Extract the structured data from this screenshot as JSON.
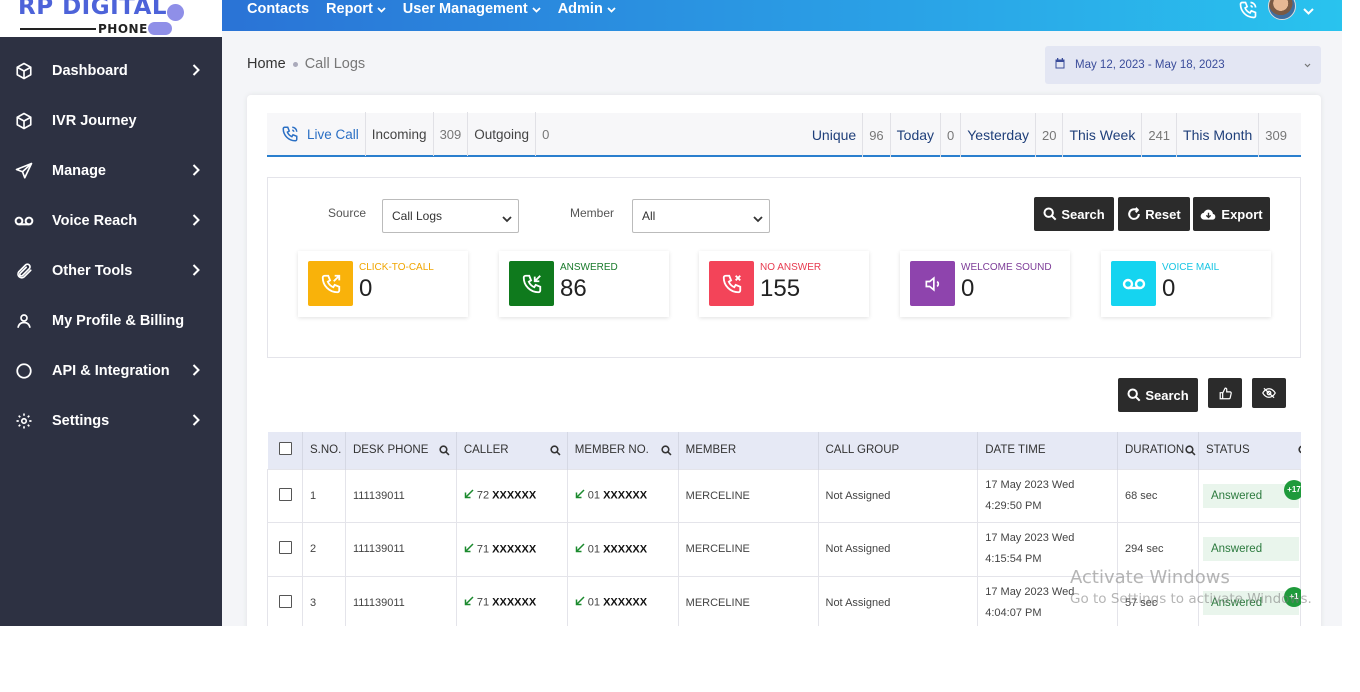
{
  "brand": {
    "name": "RP DIGITAL",
    "sub": "PHONE"
  },
  "sidebar": {
    "items": [
      {
        "label": "Dashboard",
        "icon": "cube-icon",
        "has_chevron": true
      },
      {
        "label": "IVR Journey",
        "icon": "cube-icon",
        "has_chevron": false
      },
      {
        "label": "Manage",
        "icon": "send-icon",
        "has_chevron": true
      },
      {
        "label": "Voice Reach",
        "icon": "voicemail-icon",
        "has_chevron": true
      },
      {
        "label": "Other Tools",
        "icon": "paperclip-icon",
        "has_chevron": true
      },
      {
        "label": "My Profile & Billing",
        "icon": "user-icon",
        "has_chevron": false
      },
      {
        "label": "API & Integration",
        "icon": "circle-icon",
        "has_chevron": true
      },
      {
        "label": "Settings",
        "icon": "gear-icon",
        "has_chevron": true
      }
    ]
  },
  "topnav": {
    "items": [
      {
        "label": "Contacts",
        "dropdown": false
      },
      {
        "label": "Report",
        "dropdown": true
      },
      {
        "label": "User Management",
        "dropdown": true
      },
      {
        "label": "Admin",
        "dropdown": true
      }
    ]
  },
  "breadcrumb": {
    "home": "Home",
    "current": "Call Logs"
  },
  "date_range": "May 12, 2023 - May 18, 2023",
  "tabs": {
    "live": "Live Call",
    "incoming": {
      "label": "Incoming",
      "count": "309"
    },
    "outgoing": {
      "label": "Outgoing",
      "count": "0"
    },
    "unique": {
      "label": "Unique",
      "count": "96"
    },
    "today": {
      "label": "Today",
      "count": "0"
    },
    "yesterday": {
      "label": "Yesterday",
      "count": "20"
    },
    "this_week": {
      "label": "This Week",
      "count": "241"
    },
    "this_month": {
      "label": "This Month",
      "count": "309"
    }
  },
  "filters": {
    "source_label": "Source",
    "source_value": "Call Logs",
    "member_label": "Member",
    "member_value": "All",
    "search_label": "Search",
    "reset_label": "Reset",
    "export_label": "Export"
  },
  "stats": [
    {
      "label": "CLICK-TO-CALL",
      "value": "0",
      "color": "#f9b20a",
      "label_color": "#f0a500",
      "icon": "phone-outgoing-icon"
    },
    {
      "label": "ANSWERED",
      "value": "86",
      "color": "#0f7a1d",
      "label_color": "#187a2a",
      "icon": "phone-incoming-icon"
    },
    {
      "label": "NO ANSWER",
      "value": "155",
      "color": "#f34459",
      "label_color": "#e73a4f",
      "icon": "phone-missed-icon"
    },
    {
      "label": "WELCOME SOUND",
      "value": "0",
      "color": "#8e44ad",
      "label_color": "#7d3c98",
      "icon": "speaker-icon"
    },
    {
      "label": "VOICE MAIL",
      "value": "0",
      "color": "#15d4f0",
      "label_color": "#16c5e3",
      "icon": "voicemail-icon"
    }
  ],
  "table_controls": {
    "search_label": "Search"
  },
  "table": {
    "columns": [
      "S.NO.",
      "DESK PHONE",
      "CALLER",
      "MEMBER NO.",
      "MEMBER",
      "CALL GROUP",
      "DATE TIME",
      "DURATION",
      "STATUS"
    ],
    "rows": [
      {
        "sno": "1",
        "desk_phone": "111139011",
        "caller_prefix": "72",
        "caller_mask": "XXXXXX",
        "member_prefix": "01",
        "member_mask": "XXXXXX",
        "member": "MERCELINE",
        "call_group": "Not Assigned",
        "date": "17 May 2023 Wed",
        "time": "4:29:50 PM",
        "duration": "68 sec",
        "status": "Answered",
        "badge": "+17"
      },
      {
        "sno": "2",
        "desk_phone": "111139011",
        "caller_prefix": "71",
        "caller_mask": "XXXXXX",
        "member_prefix": "01",
        "member_mask": "XXXXXX",
        "member": "MERCELINE",
        "call_group": "Not Assigned",
        "date": "17 May 2023 Wed",
        "time": "4:15:54 PM",
        "duration": "294 sec",
        "status": "Answered",
        "badge": ""
      },
      {
        "sno": "3",
        "desk_phone": "111139011",
        "caller_prefix": "71",
        "caller_mask": "XXXXXX",
        "member_prefix": "01",
        "member_mask": "XXXXXX",
        "member": "MERCELINE",
        "call_group": "Not Assigned",
        "date": "17 May 2023 Wed",
        "time": "4:04:07 PM",
        "duration": "57 sec",
        "status": "Answered",
        "badge": "+1"
      }
    ]
  },
  "watermark": {
    "line1": "Activate Windows",
    "line2": "Go to Settings to activate Windows."
  },
  "colors": {
    "sidebar_bg": "#2d3142",
    "accent": "#2a7fce",
    "topbar_start": "#2a73d6",
    "topbar_end": "#29c3ee"
  }
}
